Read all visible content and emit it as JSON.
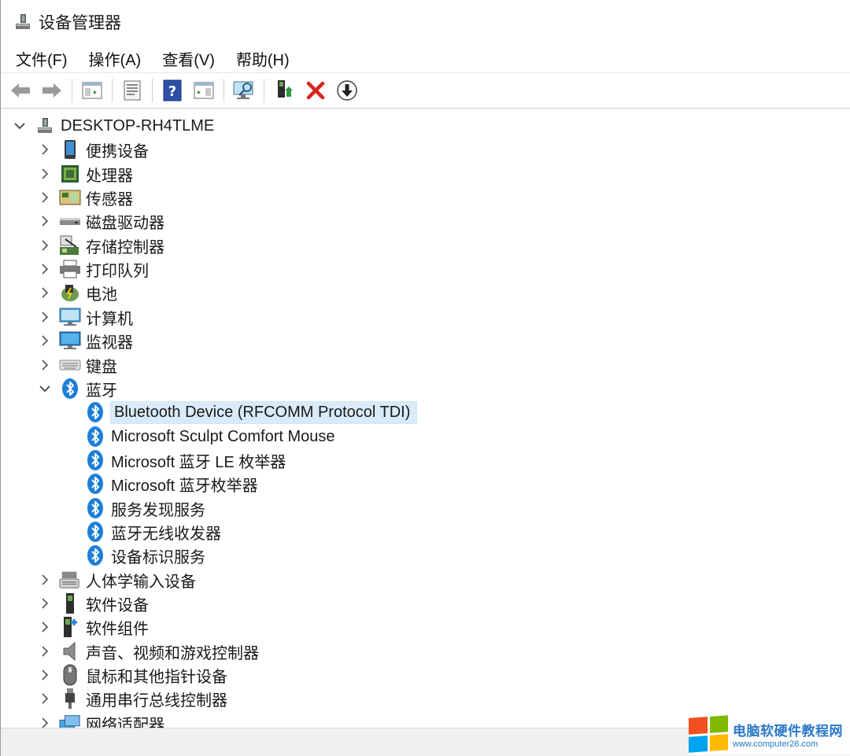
{
  "window": {
    "title": "设备管理器"
  },
  "menu": [
    {
      "label": "文件(F)"
    },
    {
      "label": "操作(A)"
    },
    {
      "label": "查看(V)"
    },
    {
      "label": "帮助(H)"
    }
  ],
  "toolbar": {
    "buttons": [
      "back-icon",
      "forward-icon",
      "show-hide-console-tree-icon",
      "properties-icon",
      "help-icon",
      "action-pane-icon",
      "scan-hardware-changes-icon",
      "update-driver-icon",
      "uninstall-device-icon",
      "disable-device-icon"
    ]
  },
  "tree": {
    "root": "DESKTOP-RH4TLME",
    "categories": [
      {
        "label": "便携设备",
        "icon": "portable-device-icon"
      },
      {
        "label": "处理器",
        "icon": "processor-icon"
      },
      {
        "label": "传感器",
        "icon": "sensor-icon"
      },
      {
        "label": "磁盘驱动器",
        "icon": "disk-drive-icon"
      },
      {
        "label": "存储控制器",
        "icon": "storage-controller-icon"
      },
      {
        "label": "打印队列",
        "icon": "printer-icon"
      },
      {
        "label": "电池",
        "icon": "battery-icon"
      },
      {
        "label": "计算机",
        "icon": "computer-icon"
      },
      {
        "label": "监视器",
        "icon": "monitor-icon"
      },
      {
        "label": "键盘",
        "icon": "keyboard-icon"
      },
      {
        "label": "蓝牙",
        "icon": "bluetooth-icon",
        "expanded": true
      }
    ],
    "bluetooth_children": [
      {
        "label": "Bluetooth Device (RFCOMM Protocol TDI)",
        "selected": true
      },
      {
        "label": "Microsoft Sculpt Comfort Mouse"
      },
      {
        "label": "Microsoft 蓝牙 LE 枚举器"
      },
      {
        "label": "Microsoft 蓝牙枚举器"
      },
      {
        "label": "服务发现服务"
      },
      {
        "label": "蓝牙无线收发器"
      },
      {
        "label": "设备标识服务"
      }
    ],
    "categories_after": [
      {
        "label": "人体学输入设备",
        "icon": "hid-icon"
      },
      {
        "label": "软件设备",
        "icon": "software-device-icon"
      },
      {
        "label": "软件组件",
        "icon": "software-component-icon"
      },
      {
        "label": "声音、视频和游戏控制器",
        "icon": "sound-icon"
      },
      {
        "label": "鼠标和其他指针设备",
        "icon": "mouse-icon"
      },
      {
        "label": "通用串行总线控制器",
        "icon": "usb-icon"
      },
      {
        "label": "网络适配器",
        "icon": "network-adapter-icon"
      }
    ]
  },
  "watermark": {
    "title": "电脑软硬件教程网",
    "url": "www.computer26.com",
    "colors": [
      "#f25022",
      "#7fba00",
      "#00a4ef",
      "#ffb900"
    ]
  },
  "colors": {
    "selection": "#d9ebf9",
    "bluetooth": "#1e7fd8"
  }
}
